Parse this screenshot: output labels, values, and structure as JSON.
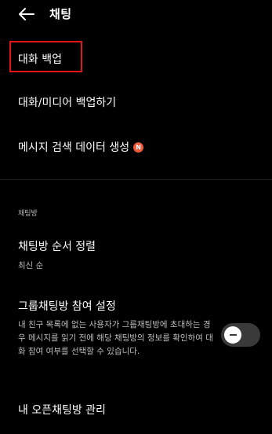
{
  "header": {
    "title": "채팅"
  },
  "items": {
    "backup": "대화 백업",
    "media_backup": "대화/미디어 백업하기",
    "search_data": "메시지 검색 데이터 생성",
    "new_badge": "N"
  },
  "section": {
    "title": "채팅방"
  },
  "sort": {
    "label": "채팅방 순서 정렬",
    "value": "최신 순"
  },
  "group_invite": {
    "label": "그룹채팅방 참여 설정",
    "description": "내 친구 목록에 없는 사용자가 그룹채팅방에 초대하는 경우 메시지를 읽기 전에 해당 채팅방의 정보를 확인하여 대화 참여 여부를 선택할 수 있습니다.",
    "toggle_on": false
  },
  "open_chat": {
    "label": "내 오픈채팅방 관리"
  },
  "colors": {
    "background": "#000000",
    "highlight": "#e4141b",
    "badge": "#f05a3a",
    "toggle_track": "#3a3a3a"
  }
}
